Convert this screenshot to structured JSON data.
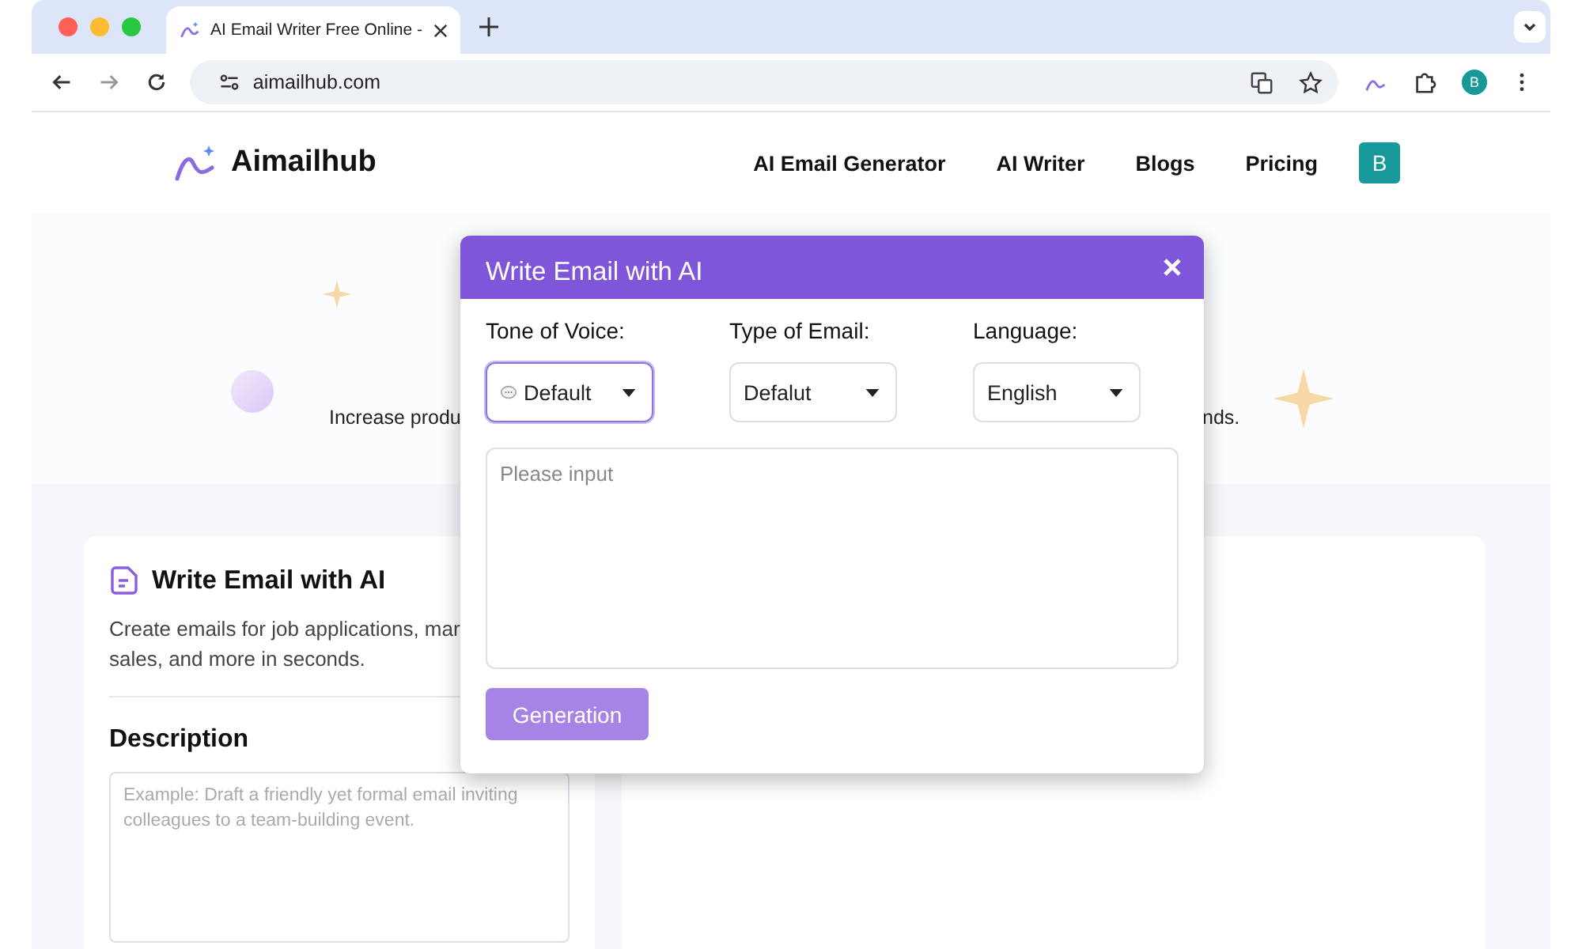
{
  "browser": {
    "tab_title": "AI Email Writer Free Online -",
    "url": "aimailhub.com",
    "profile": "B"
  },
  "site": {
    "logo": "Aimailhub",
    "nav": [
      "AI Email Generator",
      "AI Writer",
      "Blogs",
      "Pricing"
    ],
    "avatar": "B"
  },
  "hero": {
    "text_left": "Increase produ",
    "text_right": "nds."
  },
  "card": {
    "title": "Write Email with AI",
    "description_lines": [
      "Create emails for job applications, mar",
      "sales, and more in seconds."
    ],
    "section_title": "Description",
    "placeholder": "Example: Draft a friendly yet formal email inviting colleagues to a team-building event."
  },
  "modal": {
    "title": "Write Email with AI",
    "fields": [
      {
        "label": "Tone of Voice:",
        "value": "Default",
        "focused": true,
        "kind": "tone"
      },
      {
        "label": "Type of Email:",
        "value": "Defalut",
        "focused": false,
        "kind": "plain"
      },
      {
        "label": "Language:",
        "value": "English",
        "focused": false,
        "kind": "plain"
      }
    ],
    "placeholder": "Please input",
    "button": {
      "label": "Generation",
      "disabled": true
    }
  }
}
